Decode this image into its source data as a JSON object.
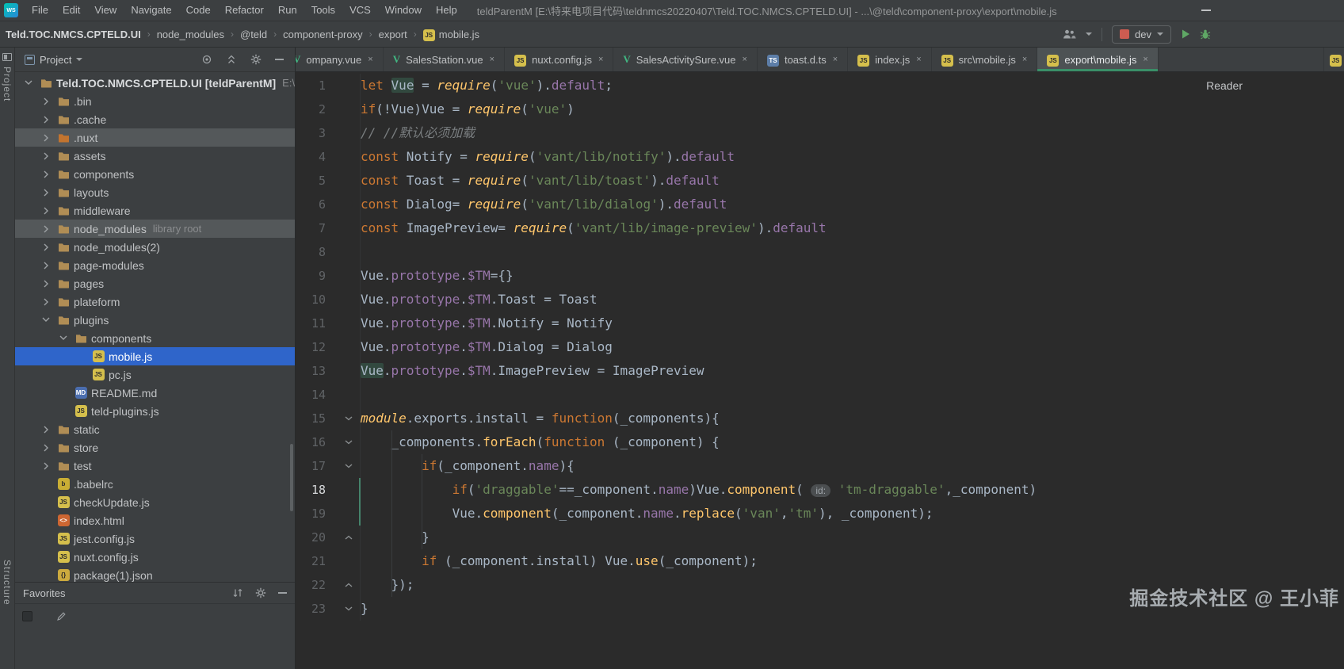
{
  "menubar": {
    "logo": "WS",
    "items": [
      "File",
      "Edit",
      "View",
      "Navigate",
      "Code",
      "Refactor",
      "Run",
      "Tools",
      "VCS",
      "Window",
      "Help"
    ],
    "window_title": "teldParentM [E:\\特来电项目代码\\teldnmcs20220407\\Teld.TOC.NMCS.CPTELD.UI] - ...\\@teld\\component-proxy\\export\\mobile.js"
  },
  "breadcrumb_bar": {
    "crumbs": [
      {
        "label": "Teld.TOC.NMCS.CPTELD.UI",
        "bold": true
      },
      {
        "label": "node_modules"
      },
      {
        "label": "@teld"
      },
      {
        "label": "component-proxy"
      },
      {
        "label": "export"
      },
      {
        "label": "mobile.js",
        "icon": "js"
      }
    ],
    "run_config": {
      "label": "dev"
    }
  },
  "tool_window_stripes": {
    "top": "Project",
    "bottom": "Structure"
  },
  "project_panel": {
    "title": "Project",
    "toolbar_icons": [
      "locate-icon",
      "collapse-all-icon",
      "settings-icon",
      "hide-icon"
    ],
    "tree": [
      {
        "label": "Teld.TOC.NMCS.CPTELD.UI [teldParentM]",
        "suffix": "E:\\",
        "depth": 0,
        "icon": "project",
        "arrow": "down",
        "bold": true
      },
      {
        "label": ".bin",
        "depth": 1,
        "icon": "folder",
        "arrow": "right"
      },
      {
        "label": ".cache",
        "depth": 1,
        "icon": "folder",
        "arrow": "right"
      },
      {
        "label": ".nuxt",
        "depth": 1,
        "icon": "folder-excluded",
        "arrow": "right",
        "row": "hover"
      },
      {
        "label": "assets",
        "depth": 1,
        "icon": "folder",
        "arrow": "right"
      },
      {
        "label": "components",
        "depth": 1,
        "icon": "folder",
        "arrow": "right"
      },
      {
        "label": "layouts",
        "depth": 1,
        "icon": "folder",
        "arrow": "right"
      },
      {
        "label": "middleware",
        "depth": 1,
        "icon": "folder",
        "arrow": "right"
      },
      {
        "label": "node_modules",
        "suffix": "library root",
        "depth": 1,
        "icon": "folder",
        "arrow": "right",
        "row": "hover"
      },
      {
        "label": "node_modules(2)",
        "depth": 1,
        "icon": "folder",
        "arrow": "right"
      },
      {
        "label": "page-modules",
        "depth": 1,
        "icon": "folder",
        "arrow": "right"
      },
      {
        "label": "pages",
        "depth": 1,
        "icon": "folder",
        "arrow": "right"
      },
      {
        "label": "plateform",
        "depth": 1,
        "icon": "folder",
        "arrow": "right"
      },
      {
        "label": "plugins",
        "depth": 1,
        "icon": "folder",
        "arrow": "down"
      },
      {
        "label": "components",
        "depth": 2,
        "icon": "folder",
        "arrow": "down"
      },
      {
        "label": "mobile.js",
        "depth": 3,
        "icon": "js",
        "row": "selected"
      },
      {
        "label": "pc.js",
        "depth": 3,
        "icon": "js"
      },
      {
        "label": "README.md",
        "depth": 2,
        "icon": "md"
      },
      {
        "label": "teld-plugins.js",
        "depth": 2,
        "icon": "js"
      },
      {
        "label": "static",
        "depth": 1,
        "icon": "folder",
        "arrow": "right"
      },
      {
        "label": "store",
        "depth": 1,
        "icon": "folder",
        "arrow": "right"
      },
      {
        "label": "test",
        "depth": 1,
        "icon": "folder",
        "arrow": "right"
      },
      {
        "label": ".babelrc",
        "depth": 1,
        "icon": "babel"
      },
      {
        "label": "checkUpdate.js",
        "depth": 1,
        "icon": "js"
      },
      {
        "label": "index.html",
        "depth": 1,
        "icon": "html"
      },
      {
        "label": "jest.config.js",
        "depth": 1,
        "icon": "js"
      },
      {
        "label": "nuxt.config.js",
        "depth": 1,
        "icon": "js"
      },
      {
        "label": "package(1).json",
        "depth": 1,
        "icon": "json"
      }
    ]
  },
  "favorites_panel": {
    "title": "Favorites",
    "toolbar_icons": [
      "sort-icon",
      "settings-icon",
      "hide-icon"
    ],
    "body_icons": [
      "list-icon",
      "edit-icon"
    ]
  },
  "editor": {
    "tabs": [
      {
        "label": "ompany.vue",
        "icon": "vue",
        "partial": true
      },
      {
        "label": "SalesStation.vue",
        "icon": "vue"
      },
      {
        "label": "nuxt.config.js",
        "icon": "js"
      },
      {
        "label": "SalesActivitySure.vue",
        "icon": "vue"
      },
      {
        "label": "toast.d.ts",
        "icon": "ts"
      },
      {
        "label": "index.js",
        "icon": "js"
      },
      {
        "label": "src\\mobile.js",
        "icon": "js"
      },
      {
        "label": "export\\mobile.js",
        "icon": "js",
        "active": true
      },
      {
        "label": "",
        "icon": "js",
        "sliver": true
      }
    ],
    "reader_label": "Reader",
    "lines": [
      {
        "n": 1,
        "t": [
          [
            "kw",
            "let"
          ],
          [
            "pl",
            " "
          ],
          [
            "hl",
            "Vue"
          ],
          [
            "pl",
            " = "
          ],
          [
            "fni",
            "require"
          ],
          [
            "pl",
            "("
          ],
          [
            "str",
            "'vue'"
          ],
          [
            "pl",
            ")."
          ],
          [
            "prop",
            "default"
          ],
          [
            "pl",
            ";"
          ]
        ]
      },
      {
        "n": 2,
        "t": [
          [
            "kw",
            "if"
          ],
          [
            "pl",
            "(!Vue)Vue = "
          ],
          [
            "fni",
            "require"
          ],
          [
            "pl",
            "("
          ],
          [
            "str",
            "'vue'"
          ],
          [
            "pl",
            ")"
          ]
        ]
      },
      {
        "n": 3,
        "t": [
          [
            "com",
            "// //默认必须加载"
          ]
        ]
      },
      {
        "n": 4,
        "t": [
          [
            "kw",
            "const"
          ],
          [
            "pl",
            " Notify = "
          ],
          [
            "fni",
            "require"
          ],
          [
            "pl",
            "("
          ],
          [
            "str",
            "'vant/lib/notify'"
          ],
          [
            "pl",
            ")."
          ],
          [
            "prop",
            "default"
          ]
        ]
      },
      {
        "n": 5,
        "t": [
          [
            "kw",
            "const"
          ],
          [
            "pl",
            " Toast = "
          ],
          [
            "fni",
            "require"
          ],
          [
            "pl",
            "("
          ],
          [
            "str",
            "'vant/lib/toast'"
          ],
          [
            "pl",
            ")."
          ],
          [
            "prop",
            "default"
          ]
        ]
      },
      {
        "n": 6,
        "t": [
          [
            "kw",
            "const"
          ],
          [
            "pl",
            " Dialog= "
          ],
          [
            "fni",
            "require"
          ],
          [
            "pl",
            "("
          ],
          [
            "str",
            "'vant/lib/dialog'"
          ],
          [
            "pl",
            ")."
          ],
          [
            "prop",
            "default"
          ]
        ]
      },
      {
        "n": 7,
        "t": [
          [
            "kw",
            "const"
          ],
          [
            "pl",
            " ImagePreview= "
          ],
          [
            "fni",
            "require"
          ],
          [
            "pl",
            "("
          ],
          [
            "str",
            "'vant/lib/image-preview'"
          ],
          [
            "pl",
            ")."
          ],
          [
            "prop",
            "default"
          ]
        ]
      },
      {
        "n": 8,
        "t": []
      },
      {
        "n": 9,
        "t": [
          [
            "pl",
            "Vue."
          ],
          [
            "prop",
            "prototype"
          ],
          [
            "pl",
            "."
          ],
          [
            "prop",
            "$TM"
          ],
          [
            "pl",
            "={}"
          ]
        ]
      },
      {
        "n": 10,
        "t": [
          [
            "pl",
            "Vue."
          ],
          [
            "prop",
            "prototype"
          ],
          [
            "pl",
            "."
          ],
          [
            "prop",
            "$TM"
          ],
          [
            "pl",
            ".Toast = Toast"
          ]
        ]
      },
      {
        "n": 11,
        "t": [
          [
            "pl",
            "Vue."
          ],
          [
            "prop",
            "prototype"
          ],
          [
            "pl",
            "."
          ],
          [
            "prop",
            "$TM"
          ],
          [
            "pl",
            ".Notify = Notify"
          ]
        ]
      },
      {
        "n": 12,
        "t": [
          [
            "pl",
            "Vue."
          ],
          [
            "prop",
            "prototype"
          ],
          [
            "pl",
            "."
          ],
          [
            "prop",
            "$TM"
          ],
          [
            "pl",
            ".Dialog = Dialog"
          ]
        ]
      },
      {
        "n": 13,
        "t": [
          [
            "hl",
            "Vue"
          ],
          [
            "pl",
            "."
          ],
          [
            "prop",
            "prototype"
          ],
          [
            "pl",
            "."
          ],
          [
            "prop",
            "$TM"
          ],
          [
            "pl",
            ".ImagePreview = ImagePreview"
          ]
        ]
      },
      {
        "n": 14,
        "t": []
      },
      {
        "n": 15,
        "fold": "down",
        "t": [
          [
            "fni",
            "module"
          ],
          [
            "pl",
            ".exports.install = "
          ],
          [
            "kw",
            "function"
          ],
          [
            "pl",
            "(_components){"
          ]
        ]
      },
      {
        "n": 16,
        "fold": "down",
        "t": [
          [
            "pl",
            "    _components."
          ],
          [
            "fn",
            "forEach"
          ],
          [
            "pl",
            "("
          ],
          [
            "kw",
            "function"
          ],
          [
            "pl",
            " (_component) {"
          ]
        ]
      },
      {
        "n": 17,
        "fold": "down",
        "t": [
          [
            "pl",
            "        "
          ],
          [
            "kw",
            "if"
          ],
          [
            "pl",
            "(_component."
          ],
          [
            "prop",
            "name"
          ],
          [
            "pl",
            "){"
          ]
        ]
      },
      {
        "n": 18,
        "current": true,
        "t": [
          [
            "pl",
            "            "
          ],
          [
            "kw",
            "if"
          ],
          [
            "pl",
            "("
          ],
          [
            "str",
            "'draggable'"
          ],
          [
            "pl",
            "==_component."
          ],
          [
            "prop",
            "name"
          ],
          [
            "pl",
            ")Vue."
          ],
          [
            "fn",
            "component"
          ],
          [
            "pl",
            "( "
          ],
          [
            "hint",
            "id:"
          ],
          [
            "pl",
            " "
          ],
          [
            "str",
            "'tm-draggable'"
          ],
          [
            "pl",
            ",_component)"
          ]
        ]
      },
      {
        "n": 19,
        "t": [
          [
            "pl",
            "            Vue."
          ],
          [
            "fn",
            "component"
          ],
          [
            "pl",
            "(_component."
          ],
          [
            "prop",
            "name"
          ],
          [
            "pl",
            "."
          ],
          [
            "fn",
            "replace"
          ],
          [
            "pl",
            "("
          ],
          [
            "str",
            "'van'"
          ],
          [
            "pl",
            ","
          ],
          [
            "str",
            "'tm'"
          ],
          [
            "pl",
            "), _component);"
          ]
        ]
      },
      {
        "n": 20,
        "fold": "up",
        "t": [
          [
            "pl",
            "        }"
          ]
        ]
      },
      {
        "n": 21,
        "t": [
          [
            "pl",
            "        "
          ],
          [
            "kw",
            "if"
          ],
          [
            "pl",
            " (_component.install) Vue."
          ],
          [
            "fn",
            "use"
          ],
          [
            "pl",
            "(_component);"
          ]
        ]
      },
      {
        "n": 22,
        "fold": "up",
        "t": [
          [
            "pl",
            "    });"
          ]
        ]
      },
      {
        "n": 23,
        "fold": "down",
        "t": [
          [
            "pl",
            "}"
          ]
        ]
      }
    ],
    "indent_guides": [
      {
        "col": 4,
        "from": 16,
        "to": 22
      },
      {
        "col": 8,
        "from": 17,
        "to": 20
      }
    ],
    "change_bars": [
      {
        "from": 18,
        "to": 19
      }
    ]
  },
  "watermark": "掘金技术社区 @ 王小菲"
}
